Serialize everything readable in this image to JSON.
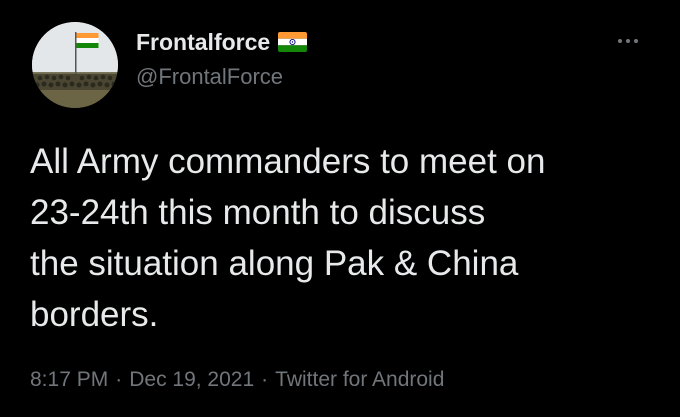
{
  "tweet": {
    "display_name": "Frontalforce",
    "handle": "@FrontalForce",
    "name_flag_icon": "india-flag-icon",
    "avatar_icon": "india-flag-soldiers-avatar",
    "more_icon": "more-options-icon",
    "text": "All Army commanders to meet on\n23-24th this month to discuss\nthe situation along Pak & China\nborders.",
    "time": "8:17 PM",
    "separator": "·",
    "date": "Dec 19, 2021",
    "source": "Twitter for Android"
  },
  "colors": {
    "background": "#000000",
    "primary_text": "#e7e9ea",
    "secondary_text": "#71767b",
    "saffron": "#ff9933",
    "white": "#ffffff",
    "green": "#138808",
    "chakra_blue": "#000080"
  }
}
